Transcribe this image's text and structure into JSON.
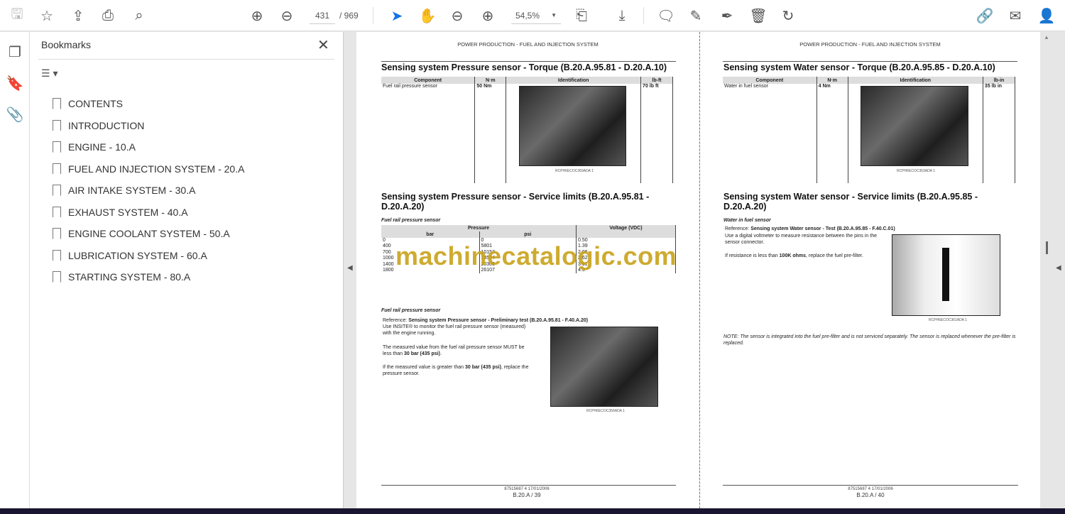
{
  "toolbar": {
    "page_current": "431",
    "page_total": "/ 969",
    "zoom": "54,5%"
  },
  "sidebar": {
    "title": "Bookmarks",
    "items": [
      {
        "label": "CONTENTS"
      },
      {
        "label": "INTRODUCTION"
      },
      {
        "label": "ENGINE - 10.A"
      },
      {
        "label": "FUEL AND INJECTION SYSTEM - 20.A"
      },
      {
        "label": "AIR INTAKE SYSTEM - 30.A"
      },
      {
        "label": "EXHAUST SYSTEM - 40.A"
      },
      {
        "label": "ENGINE COOLANT SYSTEM - 50.A"
      },
      {
        "label": "LUBRICATION SYSTEM - 60.A"
      },
      {
        "label": "STARTING SYSTEM - 80.A"
      }
    ]
  },
  "watermark": "machinecatalogic.com",
  "left_page": {
    "header": "POWER PRODUCTION - FUEL AND INJECTION SYSTEM",
    "torque_title": "Sensing system Pressure sensor - Torque (B.20.A.95.81 - D.20.A.10)",
    "torque_headers": [
      "Component",
      "N·m",
      "Identification",
      "lb-ft"
    ],
    "torque_row": [
      "Fuel rail pressure sensor",
      "50 Nm",
      "70 lb ft"
    ],
    "photo1_caption": "RCPH6ECOC369ADA   1",
    "limits_title": "Sensing system Pressure sensor - Service limits (B.20.A.95.81 - D.20.A.20)",
    "table_label": "Fuel rail pressure sensor",
    "limits_headers": {
      "pressure": "Pressure",
      "bar": "bar",
      "psi": "psi",
      "voltage": "Voltage (VDC)"
    },
    "limits_rows": [
      [
        "0",
        "0",
        "0.50"
      ],
      [
        "400",
        "5801",
        "1.39"
      ],
      [
        "700",
        "10153",
        "2.06"
      ],
      [
        "1000",
        "14504",
        "2.62"
      ],
      [
        "1400",
        "20305",
        "3.61"
      ],
      [
        "1800",
        "26107",
        "4.5"
      ]
    ],
    "test_label": "Fuel rail pressure sensor",
    "reference_prefix": "Reference:",
    "reference": "Sensing system Pressure sensor - Preliminary test (B.20.A.95.81 - F.40.A.20)",
    "para1": "Use INSITE® to monitor the fuel rail pressure sensor (measured) with the engine running.",
    "para2a": "The measured value from the fuel rail pressure sensor MUST be less than ",
    "para2b": "30 bar (435 psi)",
    "para2c": ".",
    "para3a": "If the measured value is greater than ",
    "para3b": "30 bar (435 psi)",
    "para3c": ", replace the pressure sensor.",
    "photo2_caption": "RCPH6ECOC356ADA   1",
    "footer_code": "87515687 4 17/01/2006",
    "footer_page": "B.20.A / 39"
  },
  "right_page": {
    "header": "POWER PRODUCTION - FUEL AND INJECTION SYSTEM",
    "torque_title": "Sensing system Water sensor - Torque (B.20.A.95.85 - D.20.A.10)",
    "torque_headers": [
      "Component",
      "N·m",
      "Identification",
      "lb-in"
    ],
    "torque_row": [
      "Water in fuel sensor",
      "4 Nm",
      "35 lb in"
    ],
    "photo1_caption": "RCPH6ECOC363ADA   1",
    "limits_title": "Sensing system Water sensor - Service limits (B.20.A.95.85 - D.20.A.20)",
    "test_label": "Water in fuel sensor",
    "reference_prefix": "Reference:",
    "reference": "Sensing system Water sensor - Test (B.20.A.95.85 - F.40.C.01)",
    "para1": "Use a digital voltmeter to measure resistance between the pins in the sensor connector.",
    "para2a": "If resistance is less than ",
    "para2b": "100K ohms",
    "para2c": ", replace the fuel pre-filter.",
    "photo2_caption": "RCPH6ECOC361ADA   1",
    "note": "NOTE: The sensor is integrated into the fuel pre-filter and is not serviced separately. The sensor is replaced whenever the pre-filter is replaced.",
    "footer_code": "87515687 4 17/01/2006",
    "footer_page": "B.20.A / 40"
  },
  "colors": {
    "watermark": "#c9a21a",
    "select_tool": "#1473e6"
  }
}
